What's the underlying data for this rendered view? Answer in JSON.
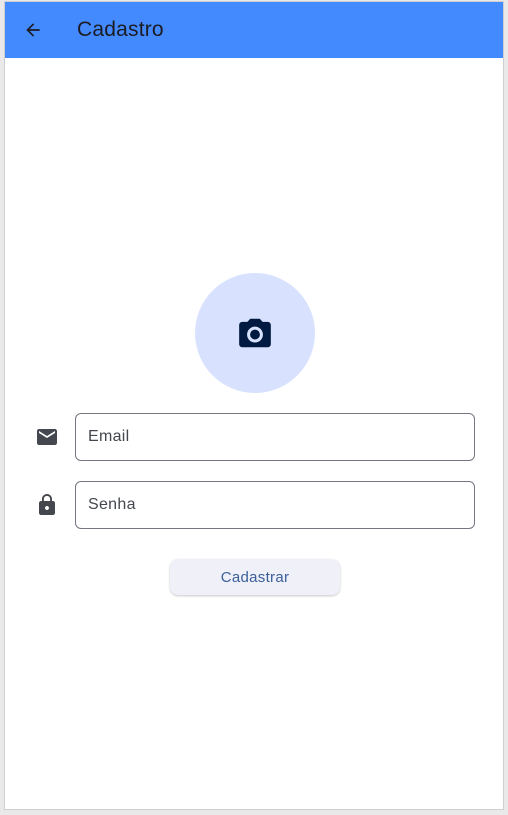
{
  "app_bar": {
    "title": "Cadastro",
    "background_color": "#448aff",
    "back_icon": "arrow-back-icon"
  },
  "avatar": {
    "icon": "camera-icon",
    "background_color": "#d8e2ff"
  },
  "form": {
    "email": {
      "icon": "mail-icon",
      "placeholder": "Email",
      "value": ""
    },
    "password": {
      "icon": "lock-icon",
      "placeholder": "Senha",
      "value": ""
    },
    "submit_label": "Cadastrar"
  }
}
